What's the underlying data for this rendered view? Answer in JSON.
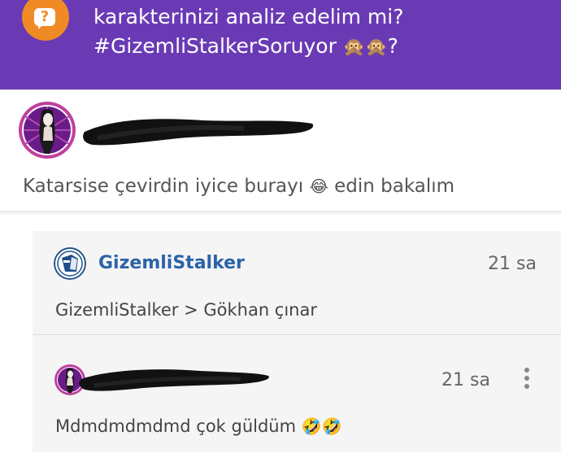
{
  "header": {
    "line1": "karakterinizi analiz edelim mi?",
    "line2": "#GizemliStalkerSoruyor",
    "line2_emoji": "🙊🙊",
    "line2_suffix": "?",
    "badge": "?"
  },
  "post": {
    "comment": "Katarsise çevirdin iyice burayı",
    "comment_emoji": "😂",
    "comment_suffix": "edin bakalım"
  },
  "reply_thread": {
    "first": {
      "author": "GizemliStalker",
      "time": "21 sa",
      "body": "GizemliStalker > Gökhan çınar"
    },
    "second": {
      "time": "21 sa",
      "body": "Mdmdmdmdmd çok güldüm",
      "body_emoji": "🤣🤣"
    }
  },
  "colors": {
    "header_bg": "#6a3ab5",
    "badge_bg": "#f08a24",
    "link_blue": "#2b63a8",
    "avatar_ring": "#c0409e"
  },
  "icons": [
    "question-bubble-icon",
    "more-vert-icon"
  ]
}
